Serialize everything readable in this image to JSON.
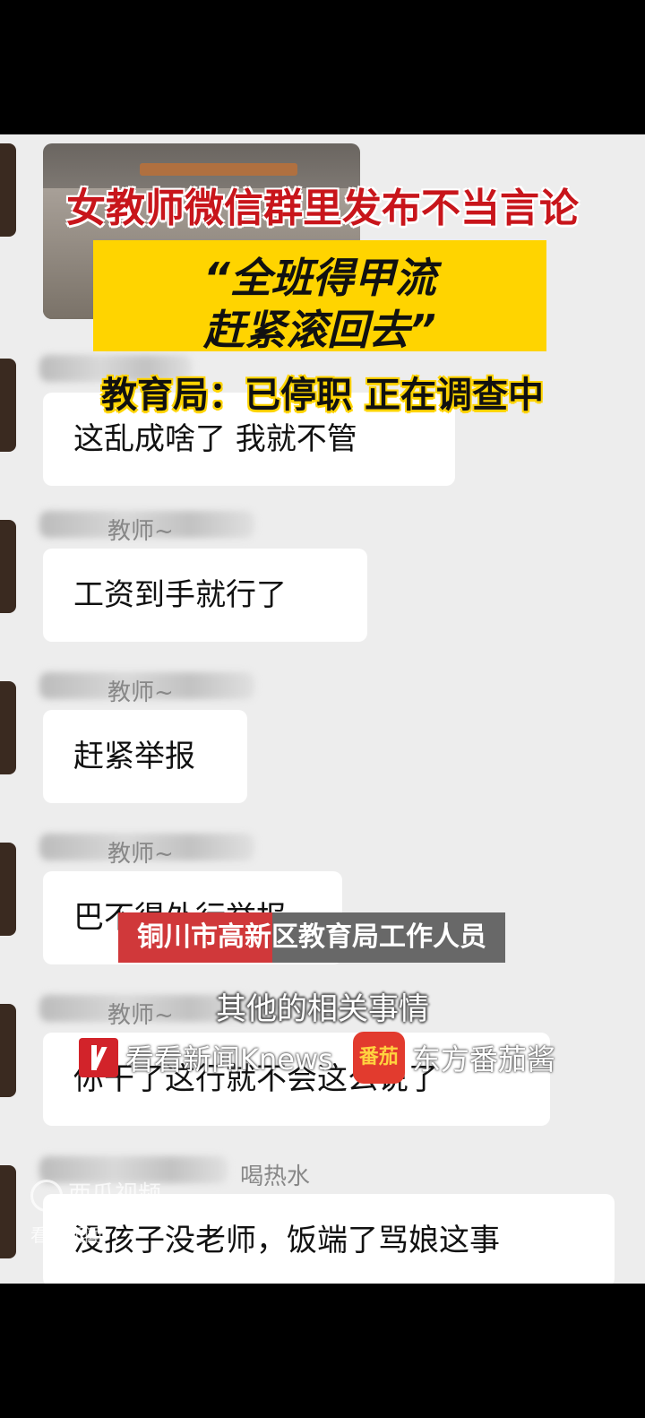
{
  "video_overlay": {
    "headline": "女教师微信群里发布不当言论",
    "quote_line1": "“全班得甲流",
    "quote_line2": "赶紧滚回去”",
    "subheadline": "教育局：已停职  正在调查中"
  },
  "messages": [
    {
      "sender": "",
      "text": "这乱成啥了 我就不管"
    },
    {
      "sender": "教师~",
      "text": "工资到手就行了"
    },
    {
      "sender": "教师~",
      "text": "赶紧举报"
    },
    {
      "sender": "教师~",
      "text": "巴不得外行举报"
    },
    {
      "sender": "教师~",
      "text": "你干了这行就不会这么说了"
    },
    {
      "sender": "喝热水",
      "text": "没孩子没老师，饭端了骂娘这事"
    }
  ],
  "captions": {
    "name_caption": "铜川市高新区教育局工作人员",
    "subtitle": "其他的相关事情"
  },
  "brands": {
    "knews_label": "看看新闻Knews",
    "fq_logo_text": "番茄",
    "fq_label": "东方番茄酱"
  },
  "watermarks": {
    "xigua": "西瓜视频",
    "kankan": "看看新闻"
  },
  "colors": {
    "headline_red": "#c8151b",
    "highlight_yellow": "#ffd400",
    "caption_red": "#d0383a"
  }
}
